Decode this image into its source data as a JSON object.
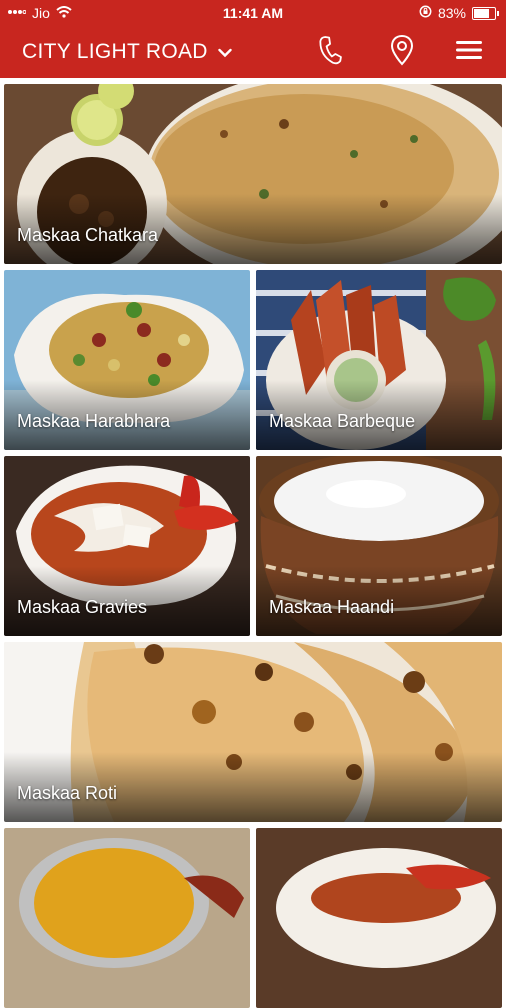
{
  "status_bar": {
    "carrier": "Jio",
    "time": "11:41 AM",
    "battery": "83%",
    "battery_level": 0.83
  },
  "header": {
    "location": "CITY LIGHT ROAD"
  },
  "menu": {
    "categories": [
      {
        "label": "Maskaa Chatkara"
      },
      {
        "label": "Maskaa Harabhara"
      },
      {
        "label": "Maskaa Barbeque"
      },
      {
        "label": "Maskaa Gravies"
      },
      {
        "label": "Maskaa Haandi"
      },
      {
        "label": "Maskaa Roti"
      }
    ]
  },
  "colors": {
    "brand": "#c8261f"
  }
}
